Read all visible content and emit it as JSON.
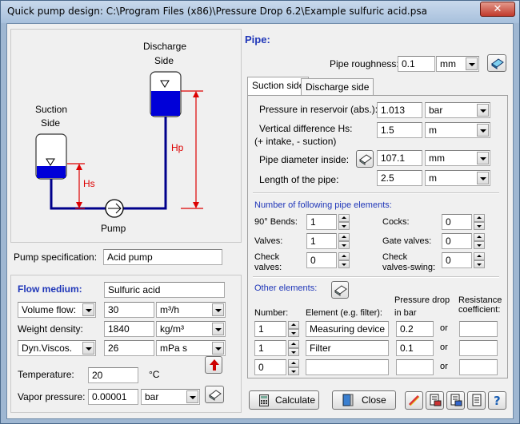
{
  "window": {
    "title": "Quick pump design: C:\\Program Files (x86)\\Pressure Drop 6.2\\Example sulfuric acid.psa",
    "close": "✕"
  },
  "diagram": {
    "discharge_label": [
      "Discharge",
      "Side"
    ],
    "suction_label": [
      "Suction",
      "Side"
    ],
    "hs_label": "Hs",
    "hp_label": "Hp",
    "pump_label": "Pump"
  },
  "pump_spec": {
    "label": "Pump specification:",
    "value": "Acid pump"
  },
  "flow": {
    "heading": "Flow medium:",
    "medium": "Sulfuric acid",
    "flow_type": "Volume flow:",
    "flow_value": "30",
    "flow_unit": "m³/h",
    "density_label": "Weight density:",
    "density_value": "1840",
    "density_unit": "kg/m³",
    "visc_type": "Dyn.Viscos.",
    "visc_value": "26",
    "visc_unit": "mPa s",
    "temp_label": "Temperature:",
    "temp_value": "20",
    "temp_unit": "°C",
    "vapor_label": "Vapor pressure:",
    "vapor_value": "0.00001",
    "vapor_unit": "bar"
  },
  "pipe": {
    "heading": "Pipe:",
    "roughness_label": "Pipe roughness:",
    "roughness_value": "0.1",
    "roughness_unit": "mm",
    "tabs": [
      "Suction side",
      "Discharge side"
    ],
    "pressure_label": "Pressure in reservoir (abs.):",
    "pressure_value": "1.013",
    "pressure_unit": "bar",
    "vert_label_1": "Vertical difference Hs:",
    "vert_label_2": "(+ intake, - suction)",
    "vert_value": "1.5",
    "vert_unit": "m",
    "diam_label": "Pipe diameter inside:",
    "diam_value": "107.1",
    "diam_unit": "mm",
    "length_label": "Length of the pipe:",
    "length_value": "2.5",
    "length_unit": "m",
    "elements_heading": "Number of following pipe elements:",
    "bends_label": "90° Bends:",
    "bends_value": "1",
    "valves_label": "Valves:",
    "valves_value": "1",
    "check_label_1": "Check",
    "check_label_2": "valves:",
    "check_value": "0",
    "cocks_label": "Cocks:",
    "cocks_value": "0",
    "gate_label": "Gate valves:",
    "gate_value": "0",
    "swing_label_1": "Check",
    "swing_label_2": "valves-swing:",
    "swing_value": "0",
    "other_heading": "Other elements:",
    "col_number": "Number:",
    "col_element": "Element (e.g. filter):",
    "col_drop_1": "Pressure drop",
    "col_drop_2": "in bar",
    "col_resist_1": "Resistance",
    "col_resist_2": "coefficient:",
    "or": "or",
    "rows": [
      {
        "number": "1",
        "element": "Measuring device",
        "drop": "0.2",
        "resist": ""
      },
      {
        "number": "1",
        "element": "Filter",
        "drop": "0.1",
        "resist": ""
      },
      {
        "number": "0",
        "element": "",
        "drop": "",
        "resist": ""
      }
    ]
  },
  "buttons": {
    "calculate": "Calculate",
    "close": "Close"
  }
}
